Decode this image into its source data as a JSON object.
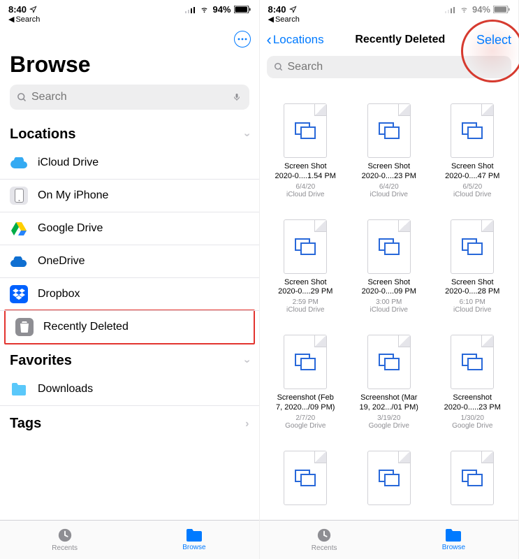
{
  "status": {
    "time": "8:40",
    "back": "Search",
    "battery": "94%"
  },
  "left": {
    "title": "Browse",
    "search_placeholder": "Search",
    "locations_header": "Locations",
    "favorites_header": "Favorites",
    "tags_header": "Tags",
    "locations": [
      {
        "label": "iCloud Drive"
      },
      {
        "label": "On My iPhone"
      },
      {
        "label": "Google Drive"
      },
      {
        "label": "OneDrive"
      },
      {
        "label": "Dropbox"
      },
      {
        "label": "Recently Deleted"
      }
    ],
    "favorites": [
      {
        "label": "Downloads"
      }
    ]
  },
  "right": {
    "back_label": "Locations",
    "title": "Recently Deleted",
    "select_label": "Select",
    "search_placeholder": "Search",
    "files": [
      {
        "name1": "Screen Shot",
        "name2": "2020-0....1.54 PM",
        "time": "6/4/20",
        "loc": "iCloud Drive"
      },
      {
        "name1": "Screen Shot",
        "name2": "2020-0....23 PM",
        "time": "6/4/20",
        "loc": "iCloud Drive"
      },
      {
        "name1": "Screen Shot",
        "name2": "2020-0....47 PM",
        "time": "6/5/20",
        "loc": "iCloud Drive"
      },
      {
        "name1": "Screen Shot",
        "name2": "2020-0....29 PM",
        "time": "2:59 PM",
        "loc": "iCloud Drive"
      },
      {
        "name1": "Screen Shot",
        "name2": "2020-0....09 PM",
        "time": "3:00 PM",
        "loc": "iCloud Drive"
      },
      {
        "name1": "Screen Shot",
        "name2": "2020-0....28 PM",
        "time": "6:10 PM",
        "loc": "iCloud Drive"
      },
      {
        "name1": "Screenshot (Feb",
        "name2": "7, 2020.../09 PM)",
        "time": "2/7/20",
        "loc": "Google Drive"
      },
      {
        "name1": "Screenshot (Mar",
        "name2": "19, 202.../01 PM)",
        "time": "3/19/20",
        "loc": "Google Drive"
      },
      {
        "name1": "Screenshot",
        "name2": "2020-0.....23 PM",
        "time": "1/30/20",
        "loc": "Google Drive"
      },
      {
        "name1": "",
        "name2": "",
        "time": "",
        "loc": ""
      },
      {
        "name1": "",
        "name2": "",
        "time": "",
        "loc": ""
      },
      {
        "name1": "",
        "name2": "",
        "time": "",
        "loc": ""
      }
    ]
  },
  "tabs": {
    "recents": "Recents",
    "browse": "Browse"
  }
}
